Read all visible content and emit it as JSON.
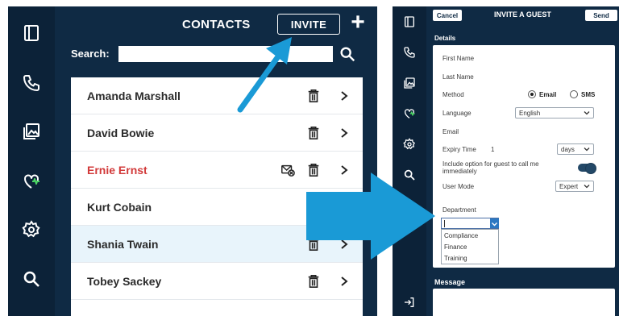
{
  "contacts_app": {
    "title": "CONTACTS",
    "invite_label": "INVITE",
    "add_label": "+",
    "search_label": "Search:",
    "search_value": "",
    "rail_icons": [
      "sidebar-toggle-icon",
      "phone-icon",
      "gallery-icon",
      "heart-pulse-icon",
      "settings-gear-icon",
      "search-icon"
    ],
    "contacts": [
      {
        "name": "Amanda Marshall",
        "status": "normal",
        "has_delete": true,
        "has_message": false
      },
      {
        "name": "David Bowie",
        "status": "normal",
        "has_delete": true,
        "has_message": false
      },
      {
        "name": "Ernie Ernst",
        "status": "alert",
        "has_delete": true,
        "has_message": true
      },
      {
        "name": "Kurt Cobain",
        "status": "normal",
        "has_delete": false,
        "has_message": false
      },
      {
        "name": "Shania Twain",
        "status": "selected",
        "has_delete": true,
        "has_message": false
      },
      {
        "name": "Tobey Sackey",
        "status": "normal",
        "has_delete": true,
        "has_message": false
      }
    ]
  },
  "invite_guest": {
    "cancel_label": "Cancel",
    "title": "INVITE A GUEST",
    "send_label": "Send",
    "details_label": "Details",
    "fields": {
      "first_name": "First Name",
      "last_name": "Last Name",
      "method": "Method",
      "method_options": [
        "Email",
        "SMS"
      ],
      "method_selected": "Email",
      "language": "Language",
      "language_value": "English",
      "email": "Email",
      "expiry_time": "Expiry Time",
      "expiry_value": "1",
      "expiry_unit": "days",
      "call_option": "Include option for guest to call me immediately",
      "call_option_enabled": true,
      "user_mode": "User Mode",
      "user_mode_value": "Expert",
      "department": "Department",
      "department_value": "",
      "department_options": [
        "Compliance",
        "Finance",
        "Training"
      ]
    },
    "message_label": "Message",
    "rail_icons": [
      "sidebar-toggle-icon",
      "phone-icon",
      "gallery-icon",
      "heart-pulse-icon",
      "settings-gear-icon",
      "search-icon",
      "logout-icon"
    ]
  },
  "colors": {
    "app_bg": "#0f2a44",
    "rail_bg": "#0c2238",
    "arrow": "#1a9ad6",
    "alert_name": "#d23a3a",
    "selected_row": "#e8f4fb"
  }
}
